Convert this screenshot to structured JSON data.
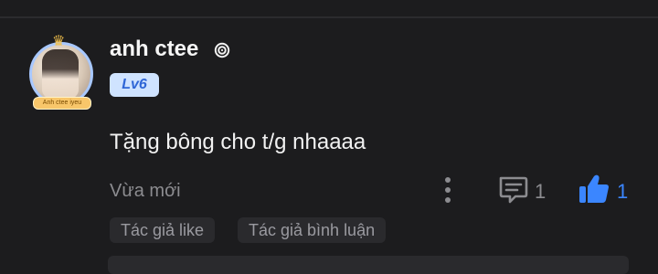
{
  "comment": {
    "username": "anh ctee",
    "level": "Lv6",
    "avatar_tag": "Anh ctee iyeu",
    "text": "Tặng bông cho t/g nhaaaa",
    "time": "Vừa mới",
    "reply_count": "1",
    "like_count": "1"
  },
  "chips": [
    {
      "label": "Tác giả like"
    },
    {
      "label": "Tác giả bình luận"
    }
  ],
  "icons": {
    "user_badge": "spiral-badge-icon",
    "more": "more-vertical-icon",
    "reply": "comment-icon",
    "like": "thumbs-up-icon"
  },
  "colors": {
    "background": "#1c1c1e",
    "accent_blue": "#3b86ff",
    "level_pill_bg": "#cfe3ff",
    "muted_text": "#8c8c90",
    "chip_bg": "#2a2a2d"
  }
}
